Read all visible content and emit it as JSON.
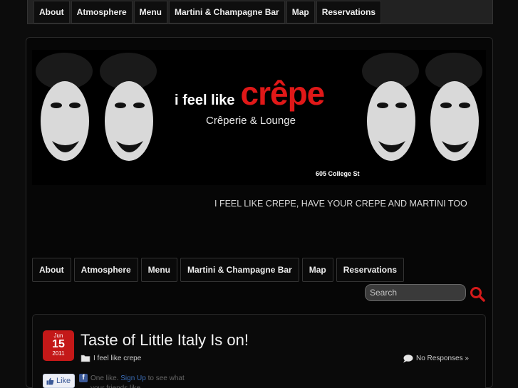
{
  "nav": {
    "items": [
      "About",
      "Atmosphere",
      "Menu",
      "Martini & Champagne Bar",
      "Map",
      "Reservations"
    ]
  },
  "banner": {
    "brand_small": "i feel like",
    "brand_big": "crêpe",
    "subtitle": "Crêperie & Lounge",
    "address": "605 College St"
  },
  "tagline": "I FEEL LIKE CREPE, HAVE YOUR CREPE AND MARTINI TOO",
  "search": {
    "placeholder": "Search"
  },
  "post": {
    "date": {
      "month": "Jun",
      "day": "15",
      "year": "2011"
    },
    "title": "Taste of Little Italy Is on!",
    "category": "I feel like crepe",
    "responses": "No Responses »"
  },
  "facebook": {
    "like_label": "Like",
    "text_prefix": "One like.",
    "signup_label": "Sign Up",
    "text_suffix": "to see what your friends like."
  },
  "colors": {
    "accent": "#e01818",
    "badge": "#c41818",
    "background": "#0c0c0c"
  }
}
